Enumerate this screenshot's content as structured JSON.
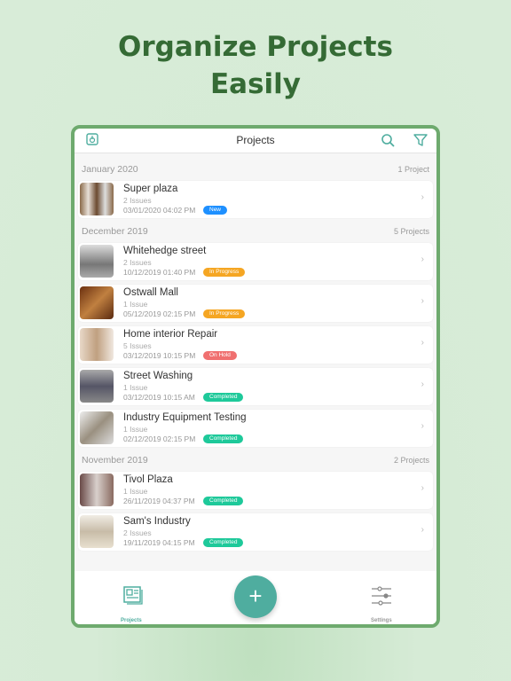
{
  "headline": {
    "line1": "Organize Projects",
    "line2": "Easily"
  },
  "topbar": {
    "title": "Projects",
    "left_icon": "export-icon",
    "search_icon": "search-icon",
    "filter_icon": "filter-icon"
  },
  "colors": {
    "accent": "#4fad9f",
    "new": "#1e90ff",
    "in_progress": "#f5a623",
    "on_hold": "#f07070",
    "completed": "#1ec99a"
  },
  "sections": [
    {
      "month": "January  2020",
      "count": "1 Project",
      "items": [
        {
          "name": "Super plaza",
          "issues": "2 Issues",
          "date": "03/01/2020 04:02 PM",
          "status": "New",
          "kind": "new"
        }
      ]
    },
    {
      "month": "December  2019",
      "count": "5 Projects",
      "items": [
        {
          "name": "Whitehedge street",
          "issues": "2 Issues",
          "date": "10/12/2019 01:40 PM",
          "status": "In Progress",
          "kind": "in_progress"
        },
        {
          "name": "Ostwall Mall",
          "issues": "1 Issue",
          "date": "05/12/2019 02:15 PM",
          "status": "In Progress",
          "kind": "in_progress"
        },
        {
          "name": "Home interior Repair",
          "issues": "5 Issues",
          "date": "03/12/2019 10:15 PM",
          "status": "On Hold",
          "kind": "on_hold"
        },
        {
          "name": "Street Washing",
          "issues": "1 Issue",
          "date": "03/12/2019 10:15 AM",
          "status": "Completed",
          "kind": "completed"
        },
        {
          "name": "Industry Equipment Testing",
          "issues": "1 Issue",
          "date": "02/12/2019 02:15 PM",
          "status": "Completed",
          "kind": "completed"
        }
      ]
    },
    {
      "month": "November  2019",
      "count": "2 Projects",
      "items": [
        {
          "name": "Tivol Plaza",
          "issues": "1 Issue",
          "date": "26/11/2019 04:37 PM",
          "status": "Completed",
          "kind": "completed"
        },
        {
          "name": "Sam's Industry",
          "issues": "2 Issues",
          "date": "19/11/2019 04:15 PM",
          "status": "Completed",
          "kind": "completed"
        }
      ]
    }
  ],
  "nav": {
    "projects": "Projects",
    "add": "+",
    "settings": "Settings"
  }
}
